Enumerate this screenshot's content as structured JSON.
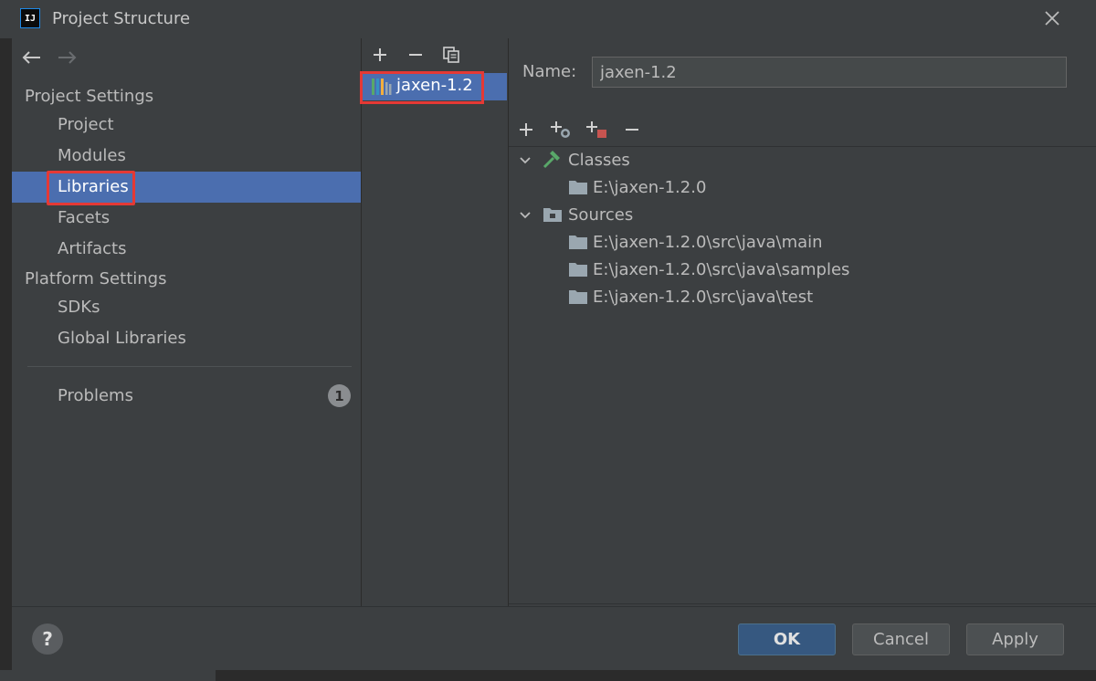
{
  "window": {
    "app_icon": "IJ",
    "title": "Project Structure"
  },
  "sidebar": {
    "section_project": "Project Settings",
    "project_items": [
      {
        "label": "Project"
      },
      {
        "label": "Modules"
      },
      {
        "label": "Libraries",
        "selected": true
      },
      {
        "label": "Facets"
      },
      {
        "label": "Artifacts"
      }
    ],
    "section_platform": "Platform Settings",
    "platform_items": [
      {
        "label": "SDKs"
      },
      {
        "label": "Global Libraries"
      }
    ],
    "problems_label": "Problems",
    "problems_count": "1"
  },
  "library_list": {
    "items": [
      {
        "label": "jaxen-1.2",
        "icon": "library-icon"
      }
    ]
  },
  "details": {
    "name_label": "Name:",
    "name_value": "jaxen-1.2",
    "tree": {
      "classes_label": "Classes",
      "classes_paths": [
        "E:\\jaxen-1.2.0"
      ],
      "sources_label": "Sources",
      "sources_paths": [
        "E:\\jaxen-1.2.0\\src\\java\\main",
        "E:\\jaxen-1.2.0\\src\\java\\samples",
        "E:\\jaxen-1.2.0\\src\\java\\test"
      ]
    }
  },
  "buttons": {
    "ok": "OK",
    "cancel": "Cancel",
    "apply": "Apply",
    "help": "?"
  },
  "colors": {
    "selection": "#4b6eaf",
    "highlight_box": "#e53935",
    "background": "#3c3f41"
  }
}
